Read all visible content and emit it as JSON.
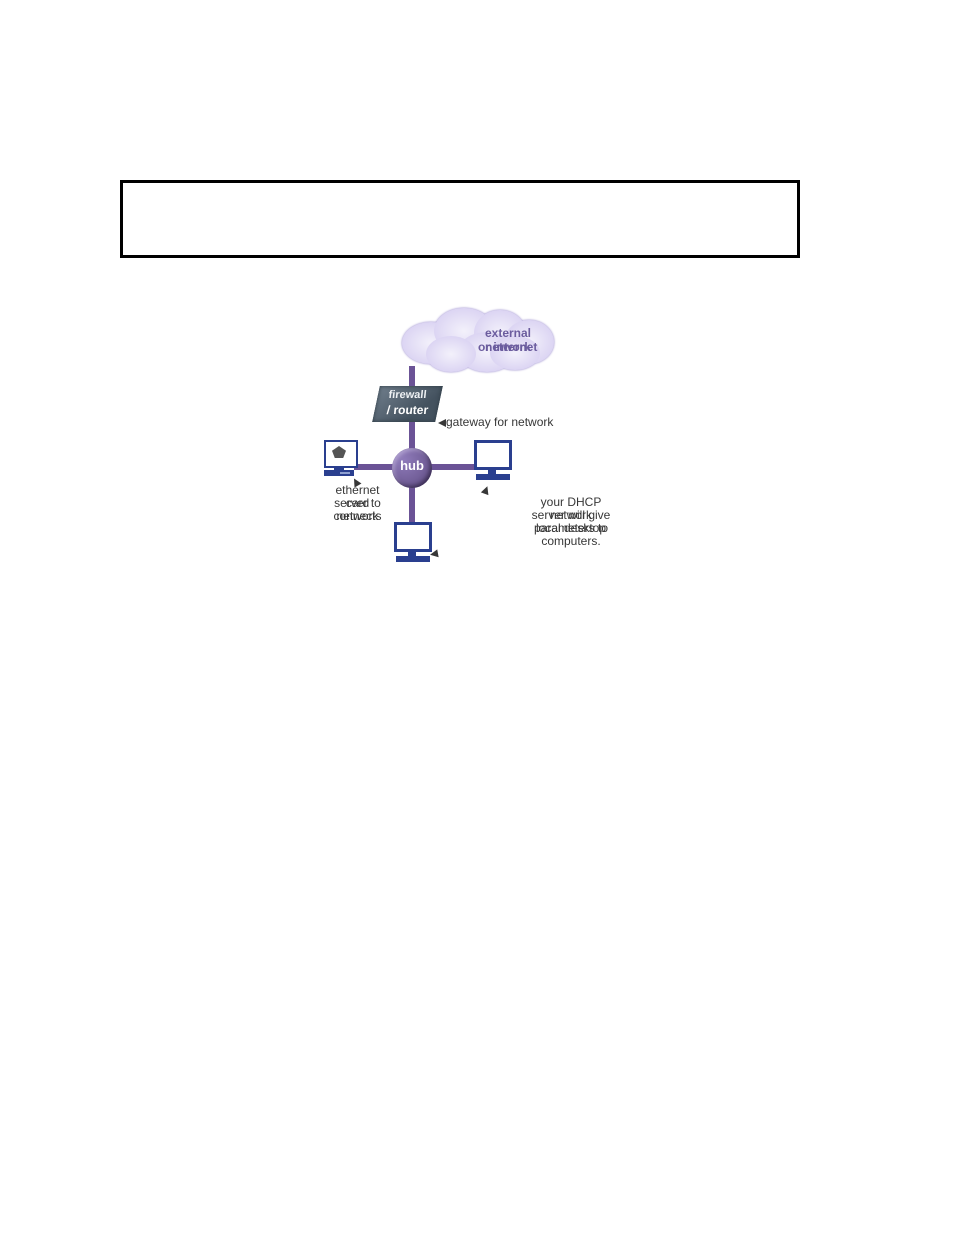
{
  "diagram": {
    "cloud": {
      "line1": "external network",
      "line2": "or internet"
    },
    "firewall": {
      "line1": "firewall",
      "line2": "/ router"
    },
    "hub": {
      "label": "hub"
    },
    "nodes": {
      "server": "server with ethernet card",
      "pc_right": "desktop computer",
      "pc_bottom": "desktop computer"
    },
    "annotations": {
      "gateway": "gateway for network",
      "ethernet": {
        "line1": "ethernet card connects",
        "line2": "server to network"
      },
      "dhcp": {
        "line1": "your DHCP server will give",
        "line2": "network parameters to",
        "line3": "local desktop computers."
      }
    },
    "connections": [
      [
        "external network or internet",
        "firewall / router"
      ],
      [
        "firewall / router",
        "hub"
      ],
      [
        "hub",
        "server with ethernet card"
      ],
      [
        "hub",
        "desktop computer (right)"
      ],
      [
        "hub",
        "desktop computer (bottom)"
      ]
    ],
    "colors": {
      "connection": "#6b5396",
      "hub": "#5d4a80",
      "device": "#2a3f8f",
      "cloud_text": "#6b5c9e",
      "annotation_text": "#373737"
    }
  }
}
